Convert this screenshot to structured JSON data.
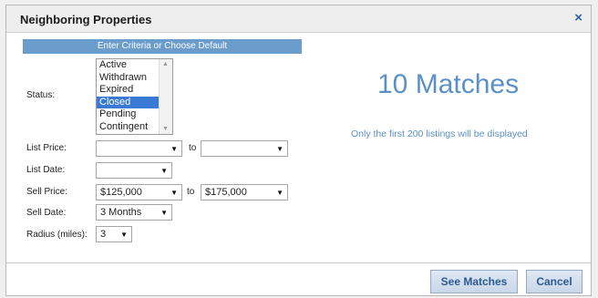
{
  "dialog": {
    "title": "Neighboring Properties",
    "close_icon": "×"
  },
  "criteria": {
    "header": "Enter Criteria or Choose Default",
    "status_label": "Status:",
    "status_options": [
      "Active",
      "Withdrawn",
      "Expired",
      "Closed",
      "Pending",
      "Contingent"
    ],
    "status_selected": "Closed",
    "list_price_label": "List Price:",
    "list_price_from": "",
    "list_price_to": "",
    "list_date_label": "List Date:",
    "list_date_value": "",
    "sell_price_label": "Sell Price:",
    "sell_price_from": "$125,000",
    "sell_price_to": "$175,000",
    "sell_date_label": "Sell Date:",
    "sell_date_value": "3 Months",
    "radius_label": "Radius (miles):",
    "radius_value": "3",
    "to_label": "to"
  },
  "results": {
    "matches_text": "10 Matches",
    "note": "Only the first 200 listings will be displayed"
  },
  "buttons": {
    "see_matches": "See Matches",
    "cancel": "Cancel"
  },
  "colors": {
    "accent": "#6a9ccc",
    "link": "#5b90c7",
    "selection": "#3a79d6"
  }
}
